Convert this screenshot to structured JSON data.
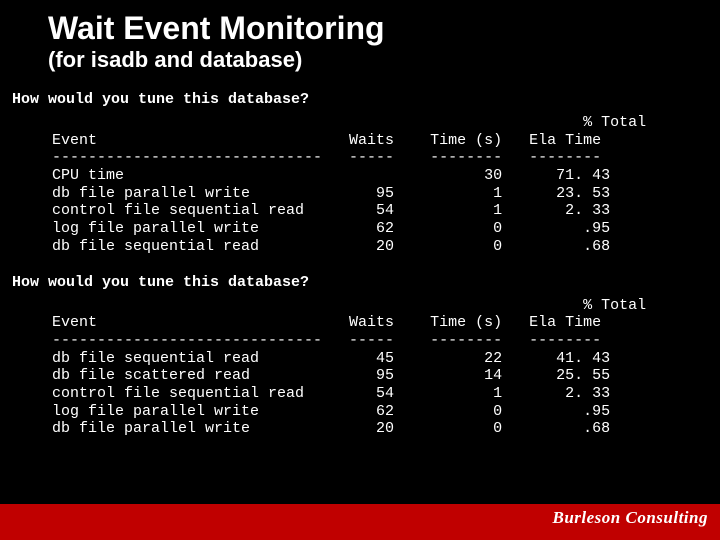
{
  "title": "Wait Event Monitoring",
  "subtitle": "(for isadb and database)",
  "question1": "How would you tune this database?",
  "question2": "How would you tune this database?",
  "block1": "                                                             % Total\n  Event                            Waits    Time (s)   Ela Time\n  ------------------------------   -----    --------   --------\n  CPU time                                        30      71. 43\n  db file parallel write              95           1      23. 53\n  control file sequential read        54           1       2. 33\n  log file parallel write             62           0         .95\n  db file sequential read             20           0         .68",
  "block2": "                                                             % Total\n  Event                            Waits    Time (s)   Ela Time\n  ------------------------------   -----    --------   --------\n  db file sequential read             45          22      41. 43\n  db file scattered read              95          14      25. 55\n  control file sequential read        54           1       2. 33\n  log file parallel write             62           0         .95\n  db file parallel write              20           0         .68",
  "brand": "Burleson Consulting",
  "chart_data": [
    {
      "type": "table",
      "title": "Wait events — database 1",
      "columns": [
        "Event",
        "Waits",
        "Time (s)",
        "% Total Ela Time"
      ],
      "rows": [
        [
          "CPU time",
          null,
          30,
          71.43
        ],
        [
          "db file parallel write",
          95,
          1,
          23.53
        ],
        [
          "control file sequential read",
          54,
          1,
          2.33
        ],
        [
          "log file parallel write",
          62,
          0,
          0.95
        ],
        [
          "db file sequential read",
          20,
          0,
          0.68
        ]
      ]
    },
    {
      "type": "table",
      "title": "Wait events — database 2",
      "columns": [
        "Event",
        "Waits",
        "Time (s)",
        "% Total Ela Time"
      ],
      "rows": [
        [
          "db file sequential read",
          45,
          22,
          41.43
        ],
        [
          "db file scattered read",
          95,
          14,
          25.55
        ],
        [
          "control file sequential read",
          54,
          1,
          2.33
        ],
        [
          "log file parallel write",
          62,
          0,
          0.95
        ],
        [
          "db file parallel write",
          20,
          0,
          0.68
        ]
      ]
    }
  ]
}
